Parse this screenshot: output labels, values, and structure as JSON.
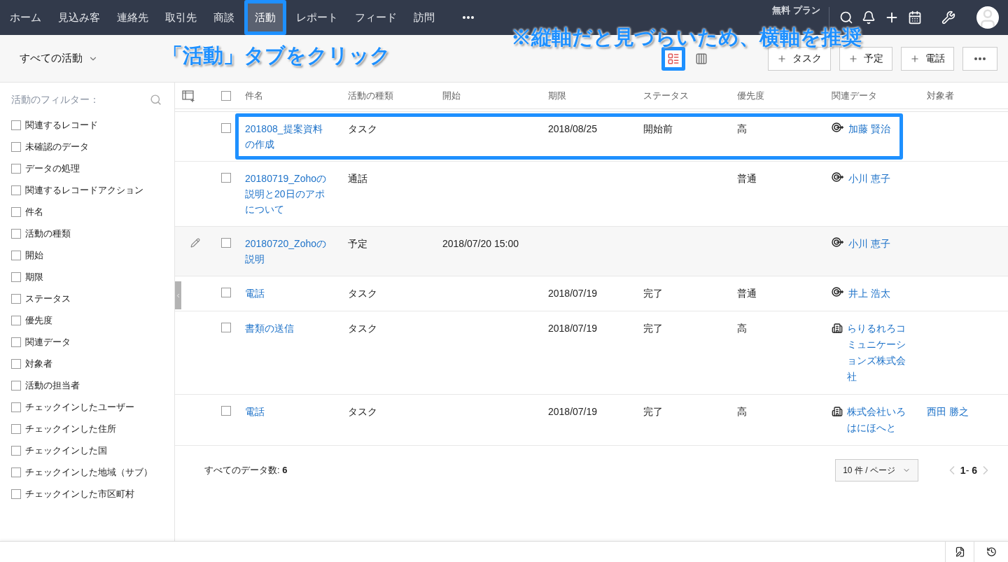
{
  "nav": {
    "tabs": [
      {
        "label": "ホーム",
        "selected": false,
        "highlighted": false
      },
      {
        "label": "見込み客",
        "selected": false,
        "highlighted": false
      },
      {
        "label": "連絡先",
        "selected": false,
        "highlighted": false
      },
      {
        "label": "取引先",
        "selected": false,
        "highlighted": false
      },
      {
        "label": "商談",
        "selected": false,
        "highlighted": false
      },
      {
        "label": "活動",
        "selected": true,
        "highlighted": true
      },
      {
        "label": "レポート",
        "selected": false,
        "highlighted": false
      },
      {
        "label": "フィード",
        "selected": false,
        "highlighted": false
      },
      {
        "label": "訪問",
        "selected": false,
        "highlighted": false
      }
    ],
    "plan": "無料 プラン"
  },
  "annotations": [
    {
      "kind": "top",
      "text": "※縦軸だと見づらいため、横軸を推奨"
    },
    {
      "kind": "toolbar",
      "text": "「活動」タブをクリック"
    }
  ],
  "toolbar": {
    "view_selector": "すべての活動",
    "views": [
      {
        "kind": "list",
        "selected": true,
        "highlighted": true
      },
      {
        "kind": "columns",
        "selected": false,
        "highlighted": false
      }
    ],
    "buttons": [
      "タスク",
      "予定",
      "電話"
    ]
  },
  "sidebar": {
    "title": "活動のフィルター：",
    "filters": [
      {
        "label": "関連するレコード",
        "checked": false
      },
      {
        "label": "未確認のデータ",
        "checked": false
      },
      {
        "label": "データの処理",
        "checked": false
      },
      {
        "label": "関連するレコードアクション",
        "checked": false
      },
      {
        "label": "件名",
        "checked": false
      },
      {
        "label": "活動の種類",
        "checked": false
      },
      {
        "label": "開始",
        "checked": false
      },
      {
        "label": "期限",
        "checked": false
      },
      {
        "label": "ステータス",
        "checked": false
      },
      {
        "label": "優先度",
        "checked": false
      },
      {
        "label": "関連データ",
        "checked": false
      },
      {
        "label": "対象者",
        "checked": false
      },
      {
        "label": "活動の担当者",
        "checked": false
      },
      {
        "label": "チェックインしたユーザー",
        "checked": false
      },
      {
        "label": "チェックインした住所",
        "checked": false
      },
      {
        "label": "チェックインした国",
        "checked": false
      },
      {
        "label": "チェックインした地域（サブ）",
        "checked": false
      },
      {
        "label": "チェックインした市区町村",
        "checked": false
      }
    ]
  },
  "table": {
    "columns": [
      "件名",
      "活動の種類",
      "開始",
      "期限",
      "ステータス",
      "優先度",
      "関連データ",
      "対象者"
    ],
    "all_checked": false,
    "rows": [
      {
        "subject": "201808_提案資料の作成",
        "type": "タスク",
        "start": "",
        "due": "2018/08/25",
        "status": "開始前",
        "priority": "高",
        "related": {
          "kind": "contact",
          "text": "加藤 賢治"
        },
        "target": "",
        "checked": false,
        "hovered": false,
        "highlighted": true
      },
      {
        "subject": "20180719_Zohoの説明と20日のアポについて",
        "type": "通話",
        "start": "",
        "due": "",
        "status": "",
        "priority": "普通",
        "related": {
          "kind": "contact",
          "text": "小川 恵子"
        },
        "target": "",
        "checked": false,
        "hovered": false,
        "highlighted": false
      },
      {
        "subject": "20180720_Zohoの説明",
        "type": "予定",
        "start": "2018/07/20 15:00",
        "due": "",
        "status": "",
        "priority": "",
        "related": {
          "kind": "contact",
          "text": "小川 恵子"
        },
        "target": "",
        "checked": false,
        "hovered": true,
        "highlighted": false
      },
      {
        "subject": "電話",
        "type": "タスク",
        "start": "",
        "due": "2018/07/19",
        "status": "完了",
        "priority": "普通",
        "related": {
          "kind": "contact",
          "text": "井上 浩太"
        },
        "target": "",
        "checked": false,
        "hovered": false,
        "highlighted": false
      },
      {
        "subject": "書類の送信",
        "type": "タスク",
        "start": "",
        "due": "2018/07/19",
        "status": "完了",
        "priority": "高",
        "related": {
          "kind": "account",
          "text": "らりるれろコミュニケーションズ株式会社"
        },
        "target": "",
        "checked": false,
        "hovered": false,
        "highlighted": false
      },
      {
        "subject": "電話",
        "type": "タスク",
        "start": "",
        "due": "2018/07/19",
        "status": "完了",
        "priority": "高",
        "related": {
          "kind": "account",
          "text": "株式会社いろはにほへと"
        },
        "target": "西田 勝之",
        "checked": false,
        "hovered": false,
        "highlighted": false
      }
    ]
  },
  "footer": {
    "total": "すべてのデータ数: **6**",
    "per_page": "10 件 / ページ",
    "range": "**1**- **6**"
  }
}
